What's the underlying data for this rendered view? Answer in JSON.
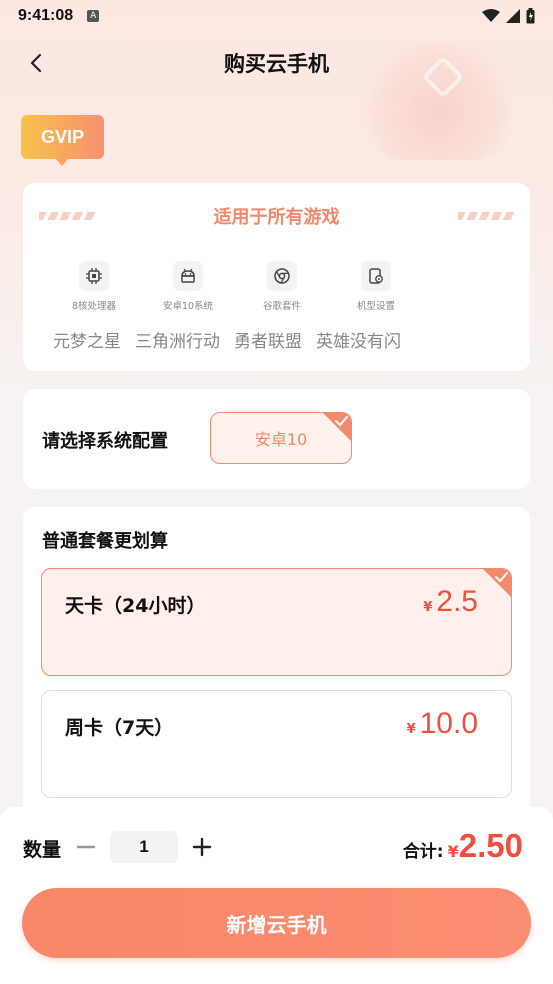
{
  "status_bar": {
    "time": "9:41:08",
    "indicator": "A"
  },
  "nav": {
    "title": "购买云手机"
  },
  "badge": {
    "label": "GVIP"
  },
  "games_card": {
    "header": "适用于所有游戏",
    "features": [
      {
        "icon": "cpu-icon",
        "label": "8核处理器"
      },
      {
        "icon": "android-icon",
        "label": "安卓10系统"
      },
      {
        "icon": "chrome-icon",
        "label": "谷歌套件"
      },
      {
        "icon": "device-settings-icon",
        "label": "机型设置"
      }
    ],
    "games": [
      "元梦之星",
      "三角洲行动",
      "勇者联盟",
      "英雄没有闪"
    ]
  },
  "config": {
    "label": "请选择系统配置",
    "selected_option": "安卓10"
  },
  "plans": {
    "title": "普通套餐更划算",
    "items": [
      {
        "name": "天卡（24小时）",
        "currency": "¥",
        "price": "2.5",
        "selected": true
      },
      {
        "name": "周卡（7天）",
        "currency": "¥",
        "price": "10.0",
        "selected": false
      }
    ]
  },
  "order": {
    "quantity_label": "数量",
    "quantity": "1",
    "total_label": "合计:",
    "total_currency": "¥",
    "total_amount": "2.50",
    "submit_label": "新增云手机"
  },
  "colors": {
    "accent": "#f38a6e",
    "price": "#f04f3f"
  }
}
